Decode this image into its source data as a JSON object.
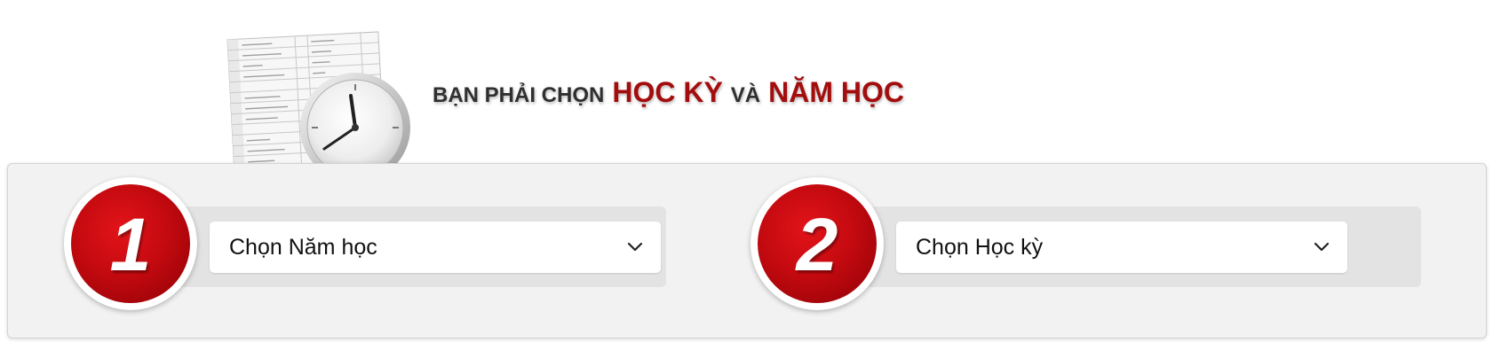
{
  "header": {
    "title_prefix": "BẠN PHẢI CHỌN",
    "title_term": "HỌC KỲ",
    "title_connector": "VÀ",
    "title_year": "NĂM HỌC",
    "illustration_icon": "schedule-clock-icon"
  },
  "steps": [
    {
      "number": "1",
      "select": {
        "selected": "Chọn Năm học"
      }
    },
    {
      "number": "2",
      "select": {
        "selected": "Chọn Học kỳ"
      }
    }
  ],
  "colors": {
    "accent_red": "#a30d0d",
    "badge_red": "#c40a10",
    "panel_bg": "#f2f2f2"
  }
}
